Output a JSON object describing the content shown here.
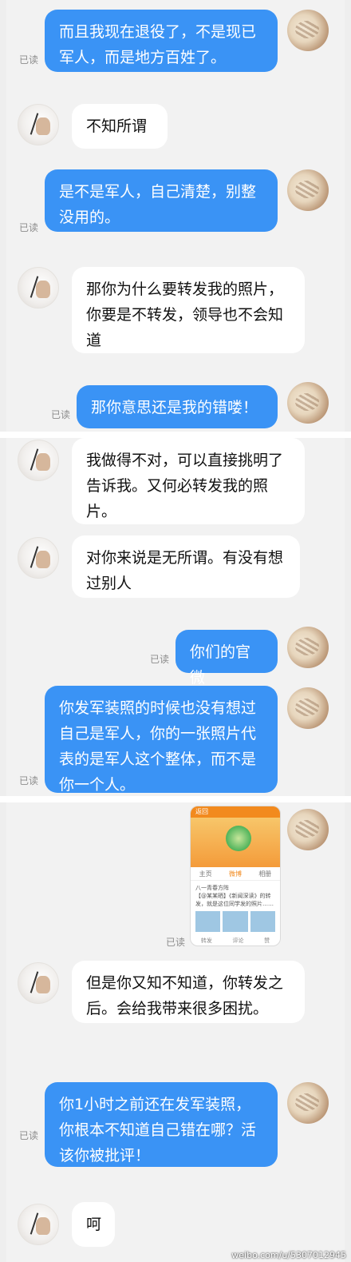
{
  "messages": [
    {
      "text": "而且我现在退役了，不是现已军人，而是地方百姓了。",
      "read": "已读"
    },
    {
      "text": "不知所谓"
    },
    {
      "text": "是不是军人，自己清楚，别整没用的。",
      "read": "已读"
    },
    {
      "text": "那你为什么要转发我的照片，你要是不转发，领导也不会知道"
    },
    {
      "text": "那你意思还是我的错喽！",
      "read": "已读"
    },
    {
      "text": "我做得不对，可以直接挑明了告诉我。又何必转发我的照片。"
    },
    {
      "text": "对你来说是无所谓。有没有想过别人"
    },
    {
      "text": "你们的官微",
      "read": "已读"
    },
    {
      "text": "你发军装照的时候也没有想过自己是军人，你的一张照片代表的是军人这个整体，而不是你一个人。",
      "read": "已读"
    },
    {
      "text": "",
      "read": "已读"
    },
    {
      "text": "但是你又知不知道，你转发之后。会给我带来很多困扰。"
    },
    {
      "text": "你1小时之前还在发军装照，你根本不知道自己错在哪？活该你被批评！",
      "read": "已读"
    },
    {
      "text": "呵"
    }
  ],
  "shared_image": {
    "top_label": "返回",
    "tabs": [
      "主页",
      "微博",
      "相册"
    ],
    "post_title": "八一青春方阵",
    "post_text": "【@某某晒】《新闻深读》的转发，就是这位同学发的照片……",
    "footer": [
      "转发",
      "评论",
      "赞"
    ]
  },
  "watermark": "weibo.com/u/5307012945"
}
